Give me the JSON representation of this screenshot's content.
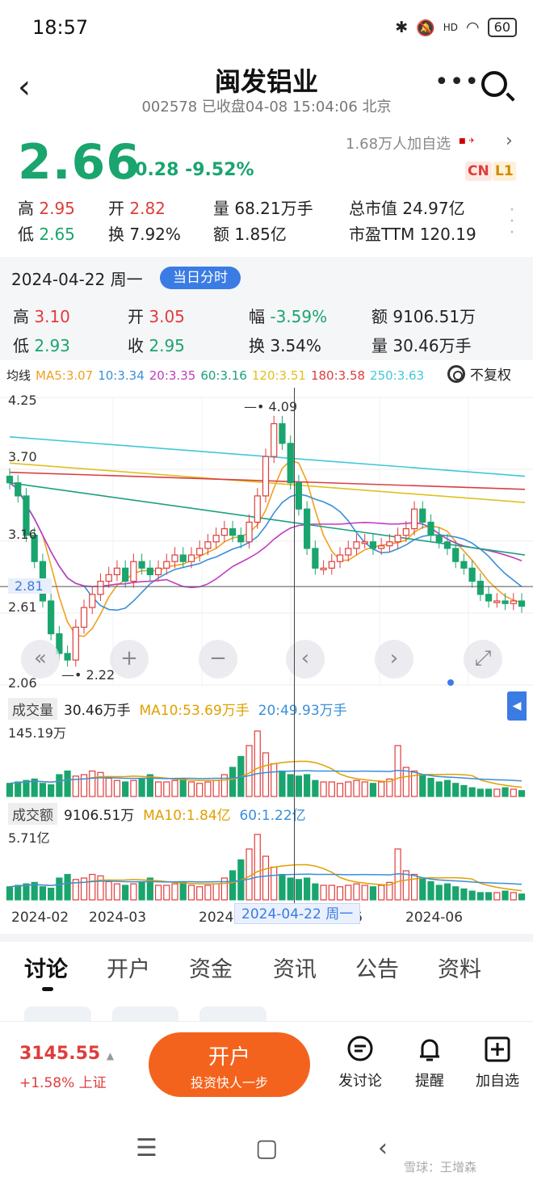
{
  "status": {
    "time": "18:57",
    "signal": "HD",
    "battery": "60"
  },
  "header": {
    "title": "闽发铝业",
    "subtitle": "002578 已收盘04-08 15:04:06 北京"
  },
  "quote": {
    "price": "2.66",
    "change": "-0.28",
    "change_pct": "-9.52%",
    "watchers": "1.68万人加自选",
    "badge_cn": "CN",
    "badge_l1": "L1",
    "high_label": "高",
    "high": "2.95",
    "open_label": "开",
    "open": "2.82",
    "vol_label": "量",
    "vol": "68.21万手",
    "mcap_label": "总市值",
    "mcap": "24.97亿",
    "low_label": "低",
    "low": "2.65",
    "turn_label": "换",
    "turn": "7.92%",
    "amt_label": "额",
    "amt": "1.85亿",
    "pe_label": "市盈TTM",
    "pe": "120.19"
  },
  "day": {
    "date": "2024-04-22 周一",
    "pill": "当日分时",
    "high_label": "高",
    "high": "3.10",
    "open_label": "开",
    "open": "3.05",
    "amp_label": "幅",
    "amp": "-3.59%",
    "amt_label": "额",
    "amt": "9106.51万",
    "low_label": "低",
    "low": "2.93",
    "close_label": "收",
    "close": "2.95",
    "turn_label": "换",
    "turn": "3.54%",
    "vol_label": "量",
    "vol": "30.46万手"
  },
  "ma": {
    "label": "均线",
    "items": [
      {
        "text": "MA5:3.07",
        "color": "#f0a020"
      },
      {
        "text": "10:3.34",
        "color": "#3a8fd8"
      },
      {
        "text": "20:3.35",
        "color": "#c03cc0"
      },
      {
        "text": "60:3.16",
        "color": "#1aa080"
      },
      {
        "text": "120:3.51",
        "color": "#e0c020"
      },
      {
        "text": "180:3.58",
        "color": "#d84040"
      },
      {
        "text": "250:3.63",
        "color": "#40c8d8"
      }
    ],
    "adjust": "不复权"
  },
  "chart_data": {
    "type": "candlestick",
    "y_ticks": [
      "4.25",
      "3.70",
      "3.16",
      "2.61",
      "2.06"
    ],
    "cursor_price": "2.81",
    "ylim": [
      2.06,
      4.25
    ],
    "high_note": "4.09",
    "low_note": "2.22",
    "x_ticks": [
      "2024-02",
      "2024-03",
      "2024",
      "6",
      "2024-06"
    ],
    "closes": [
      3.6,
      3.5,
      3.2,
      3.0,
      2.7,
      2.45,
      2.3,
      2.25,
      2.5,
      2.65,
      2.75,
      2.85,
      2.9,
      2.95,
      2.85,
      3.0,
      2.95,
      2.9,
      2.95,
      3.0,
      3.05,
      3.0,
      3.05,
      3.1,
      3.15,
      3.2,
      3.25,
      3.2,
      3.15,
      3.3,
      3.5,
      3.8,
      4.05,
      3.9,
      3.6,
      3.4,
      3.1,
      2.95,
      2.95,
      3.0,
      3.05,
      3.1,
      3.15,
      3.15,
      3.1,
      3.12,
      3.15,
      3.2,
      3.25,
      3.4,
      3.3,
      3.2,
      3.15,
      3.1,
      3.0,
      2.95,
      2.85,
      2.75,
      2.7,
      2.7,
      2.68,
      2.7,
      2.66
    ]
  },
  "volume": {
    "label": "成交量",
    "value": "30.46万手",
    "ma10": "MA10:53.69万手",
    "ma20": "20:49.93万手",
    "max": "145.19万",
    "bars": [
      0.18,
      0.2,
      0.22,
      0.24,
      0.18,
      0.16,
      0.3,
      0.35,
      0.28,
      0.3,
      0.35,
      0.33,
      0.25,
      0.22,
      0.2,
      0.22,
      0.25,
      0.3,
      0.2,
      0.2,
      0.22,
      0.24,
      0.2,
      0.18,
      0.2,
      0.22,
      0.3,
      0.4,
      0.55,
      0.7,
      0.9,
      0.6,
      0.45,
      0.35,
      0.3,
      0.28,
      0.3,
      0.22,
      0.2,
      0.2,
      0.18,
      0.2,
      0.22,
      0.2,
      0.18,
      0.2,
      0.24,
      0.7,
      0.4,
      0.35,
      0.3,
      0.25,
      0.2,
      0.22,
      0.18,
      0.15,
      0.12,
      0.1,
      0.1,
      0.1,
      0.12,
      0.1,
      0.08
    ]
  },
  "amount": {
    "label": "成交额",
    "value": "9106.51万",
    "ma10": "MA10:1.84亿",
    "ma60": "60:1.22亿",
    "max": "5.71亿"
  },
  "crosshair_date": "2024-04-22 周一",
  "tabs": [
    "讨论",
    "开户",
    "资金",
    "资讯",
    "公告",
    "资料"
  ],
  "bottom": {
    "index_val": "3145.55",
    "index_chg": "+1.58% 上证",
    "open_btn": "开户",
    "open_sub": "投资快人一步",
    "actions": [
      {
        "label": "发讨论"
      },
      {
        "label": "提醒"
      },
      {
        "label": "加自选"
      }
    ]
  },
  "watermark": "雪球：王增森"
}
